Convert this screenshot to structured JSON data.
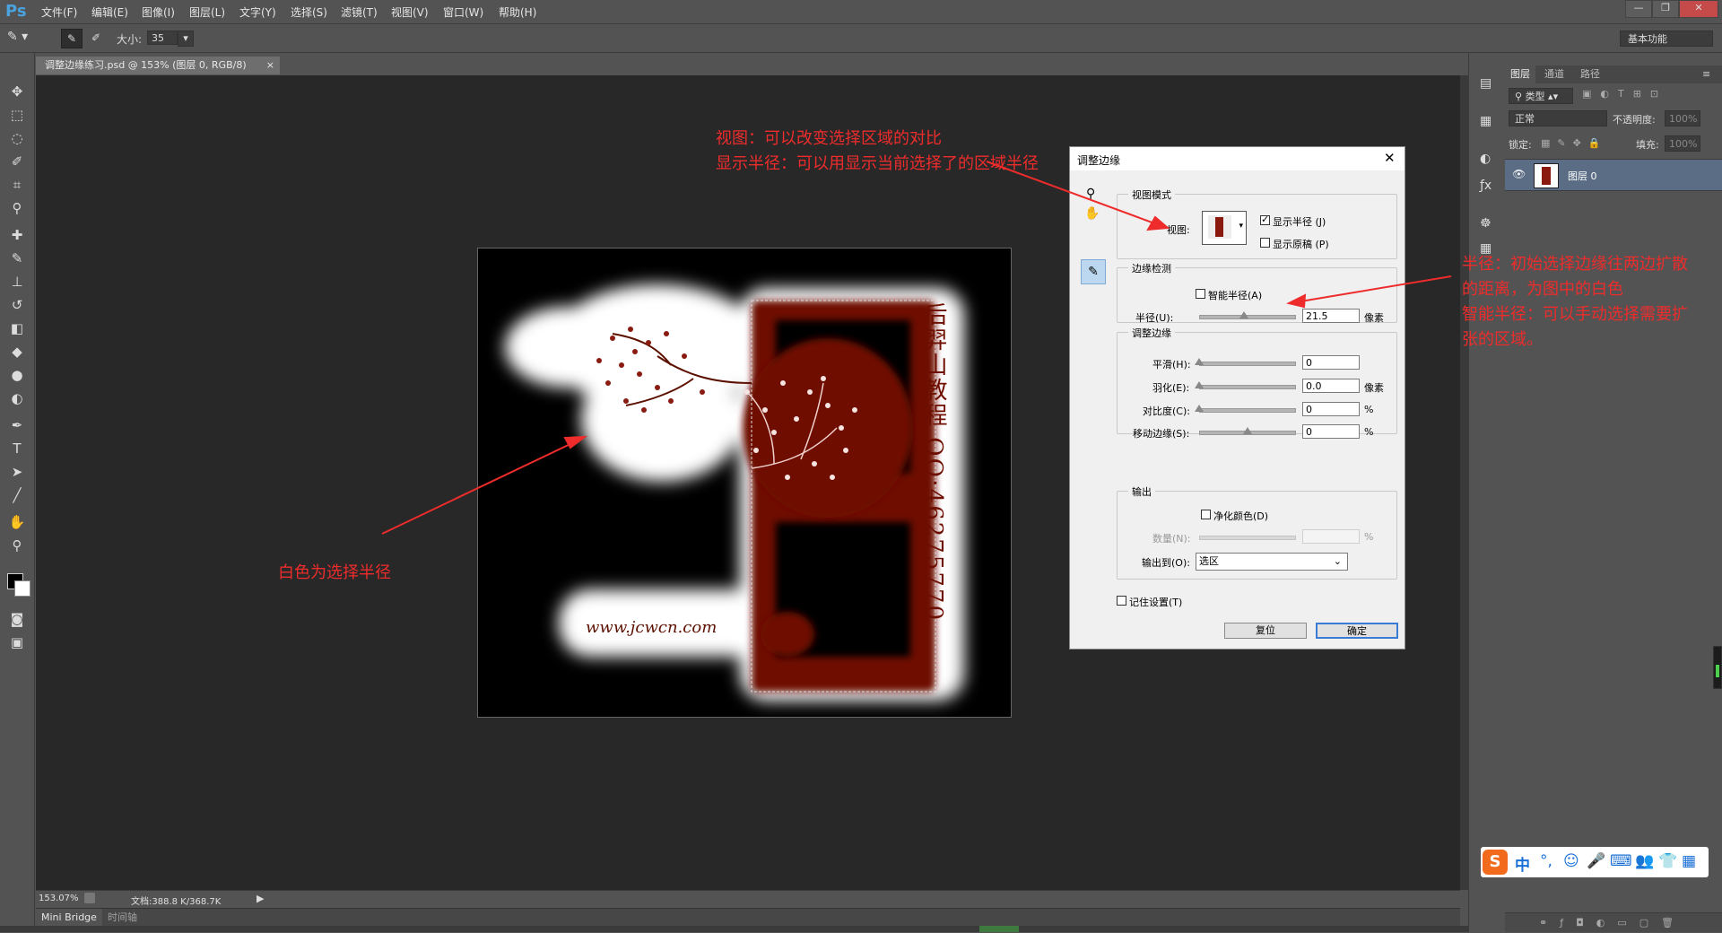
{
  "app": {
    "logo": "Ps",
    "menu": [
      "文件(F)",
      "编辑(E)",
      "图像(I)",
      "图层(L)",
      "文字(Y)",
      "选择(S)",
      "滤镜(T)",
      "视图(V)",
      "窗口(W)",
      "帮助(H)"
    ],
    "window_buttons": [
      "—",
      "❐",
      "✕"
    ]
  },
  "options": {
    "size_label": "大小:",
    "size_value": "35",
    "workspace": "基本功能"
  },
  "document": {
    "tab_title": "调整边缘练习.psd @ 153% (图层 0, RGB/8)",
    "watermark_url": "www.jcwcn.com",
    "watermark_vertical": "后羿山教程 QQ:46275770"
  },
  "status": {
    "zoom": "153.07%",
    "doc_info": "文档:388.8 K/368.7K",
    "tabs": [
      "Mini Bridge",
      "时间轴"
    ]
  },
  "layers": {
    "tabs": [
      "图层",
      "通道",
      "路径"
    ],
    "filter_kind": "类型",
    "blend_mode": "正常",
    "opacity_label": "不透明度:",
    "opacity_value": "100%",
    "lock_label": "锁定:",
    "fill_label": "填充:",
    "fill_value": "100%",
    "items": [
      {
        "name": "图层 0"
      }
    ]
  },
  "dialog": {
    "title": "调整边缘",
    "view_mode": {
      "legend": "视图模式",
      "view_label": "视图:",
      "show_radius": "显示半径 (J)",
      "show_radius_checked": true,
      "show_original": "显示原稿 (P)",
      "show_original_checked": false
    },
    "edge_detection": {
      "legend": "边缘检测",
      "smart_radius": "智能半径(A)",
      "smart_radius_checked": false,
      "radius_label": "半径(U):",
      "radius_value": "21.5",
      "radius_unit": "像素",
      "radius_fraction": 0.43
    },
    "adjust_edge": {
      "legend": "调整边缘",
      "smooth_label": "平滑(H):",
      "smooth_value": "0",
      "feather_label": "羽化(E):",
      "feather_value": "0.0",
      "feather_unit": "像素",
      "contrast_label": "对比度(C):",
      "contrast_value": "0",
      "contrast_unit": "%",
      "shift_label": "移动边缘(S):",
      "shift_value": "0",
      "shift_unit": "%"
    },
    "output": {
      "legend": "输出",
      "decontaminate": "净化颜色(D)",
      "decontaminate_checked": false,
      "amount_label": "数量(N):",
      "amount_unit": "%",
      "output_to_label": "输出到(O):",
      "output_to_value": "选区"
    },
    "remember": "记住设置(T)",
    "remember_checked": false,
    "reset_button": "复位",
    "ok_button": "确定"
  },
  "annotations": {
    "top_line1": "视图：可以改变选择区域的对比",
    "top_line2": "显示半径：可以用显示当前选择了的区域半径",
    "right_line1": "半径：初始选择边缘往两边扩散",
    "right_line2": "的距离，为图中的白色",
    "right_line3": "智能半径：可以手动选择需要扩",
    "right_line4": "张的区域。",
    "left_note": "白色为选择半径",
    "color": "#ee2c2c"
  },
  "ime": {
    "label": "中"
  }
}
